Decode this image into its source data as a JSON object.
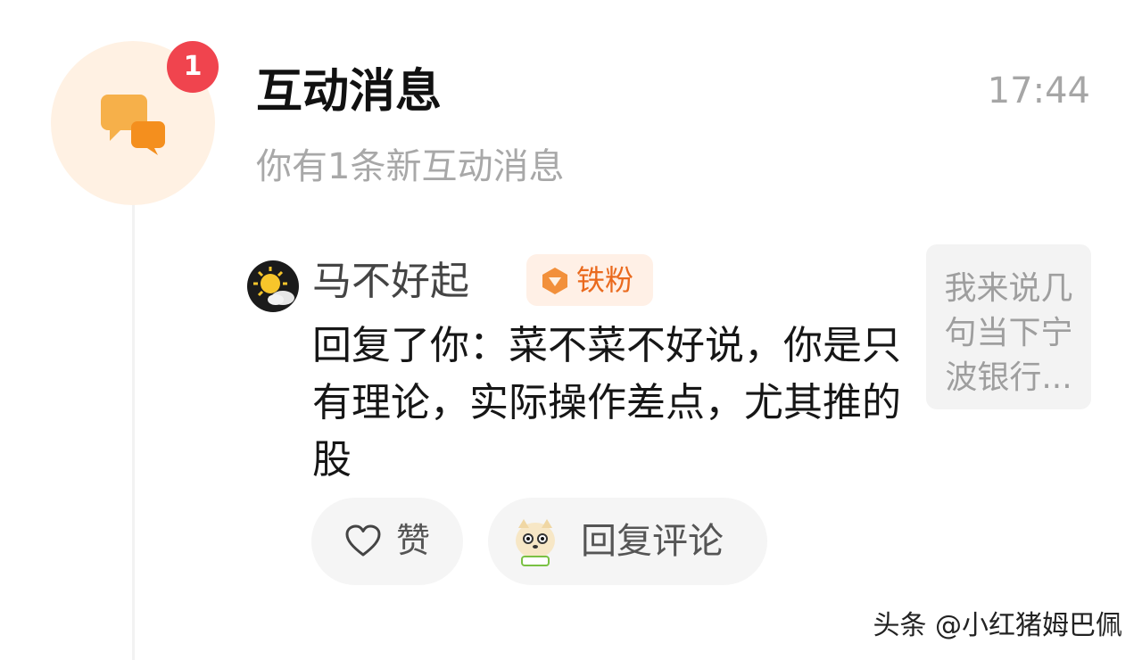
{
  "notification": {
    "title": "互动消息",
    "time": "17:44",
    "subtitle": "你有1条新互动消息",
    "badge_count": "1",
    "icon": "chat-bubbles-icon"
  },
  "comment": {
    "user_name": "马不好起",
    "fan_badge": "铁粉",
    "reply_text": "回复了你：菜不菜不好说，你是只有理论，实际操作差点，尤其推的股",
    "thumbnail_text": "我来说几句当下宁波银行..."
  },
  "actions": {
    "like_label": "赞",
    "reply_label": "回复评论"
  },
  "watermark": "头条 @小红猪姆巴佩",
  "colors": {
    "accent": "#f6a53b",
    "badge_red": "#f0444e",
    "fan_orange": "#ea6a1e"
  }
}
